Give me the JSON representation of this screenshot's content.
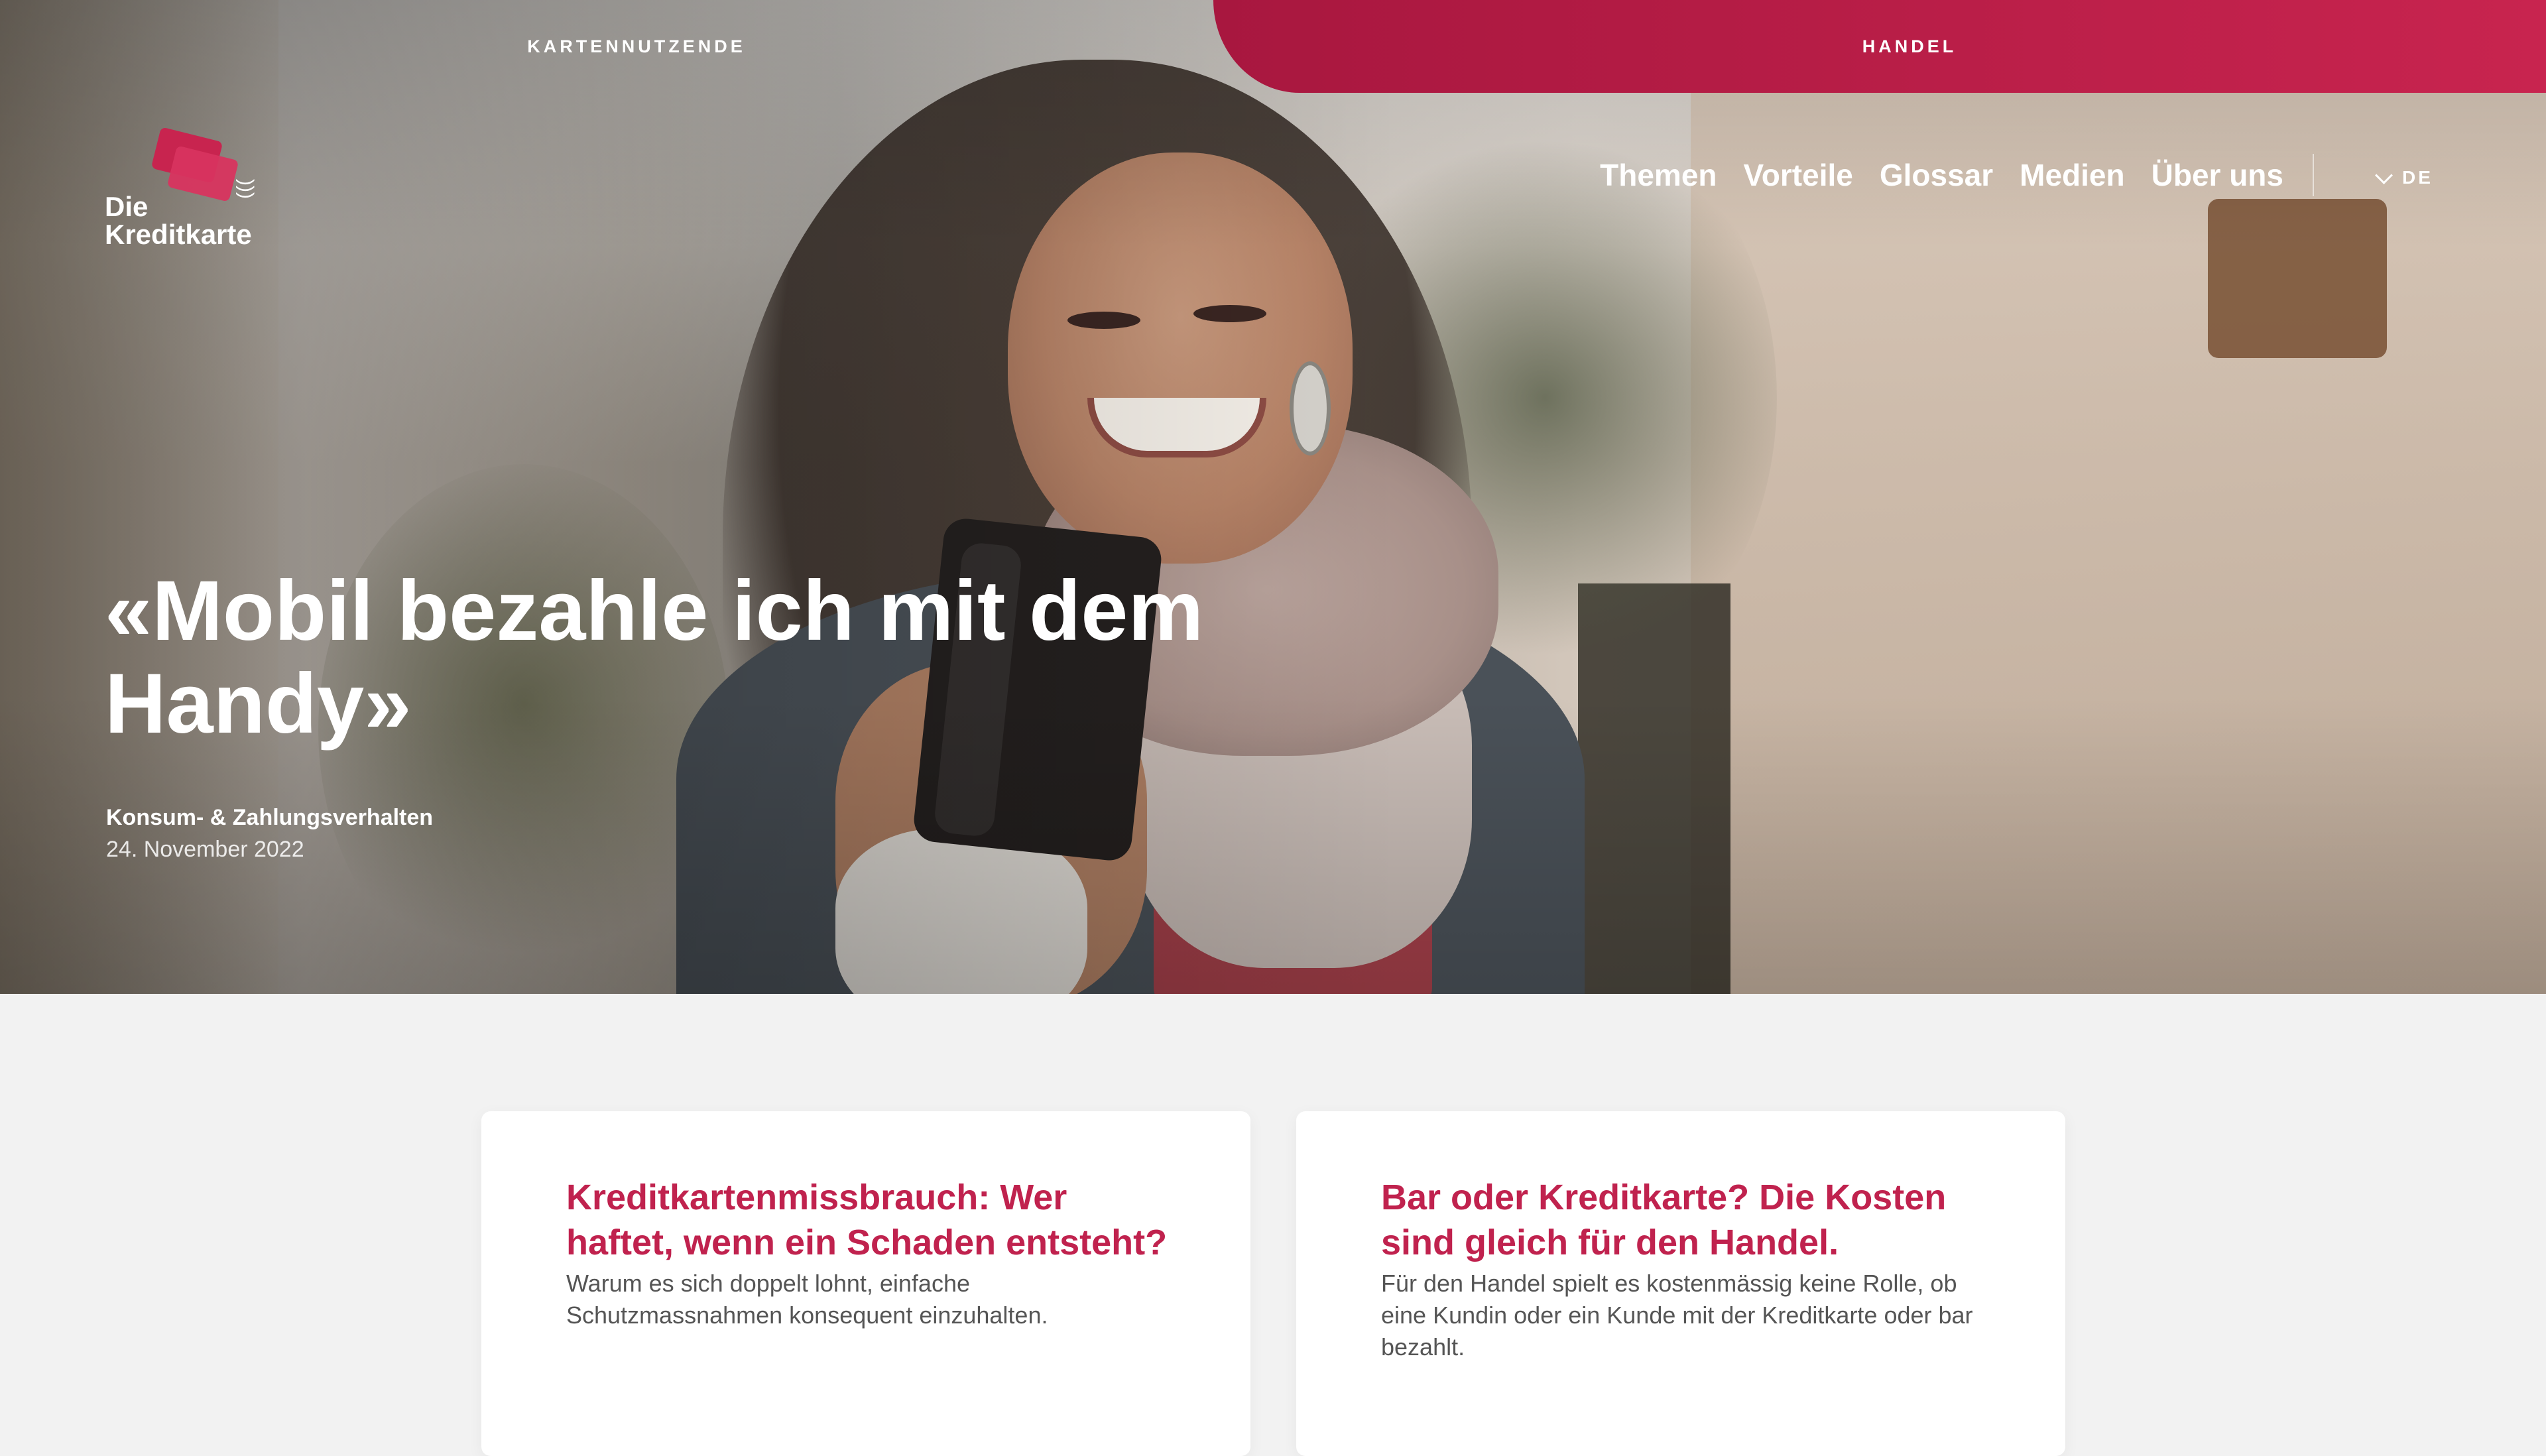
{
  "topbar": {
    "left_label": "KARTENNUTZENDE",
    "right_label": "HANDEL"
  },
  "logo": {
    "line1": "Die",
    "line2": "Kreditkarte"
  },
  "nav": {
    "items": [
      "Themen",
      "Vorteile",
      "Glossar",
      "Medien",
      "Über uns"
    ],
    "language": "DE"
  },
  "hero": {
    "headline": "«Mobil bezahle ich mit dem Handy»",
    "category": "Konsum- & Zahlungsverhalten",
    "date": "24. November 2022"
  },
  "cards": [
    {
      "title": "Kreditkartenmissbrauch: Wer haftet, wenn ein Schaden entsteht?",
      "text": "Warum es sich doppelt lohnt, einfache Schutzmassnahmen konsequent einzuhalten."
    },
    {
      "title": "Bar oder Kreditkarte? Die Kosten sind gleich für den Handel.",
      "text": "Für den Handel spielt es kostenmässig keine Rolle, ob eine Kundin oder ein Kunde mit der Kreditkarte oder bar bezahlt."
    }
  ],
  "colors": {
    "brand": "#c0224e",
    "page_background": "#f2f2f2",
    "card_background": "#ffffff"
  }
}
